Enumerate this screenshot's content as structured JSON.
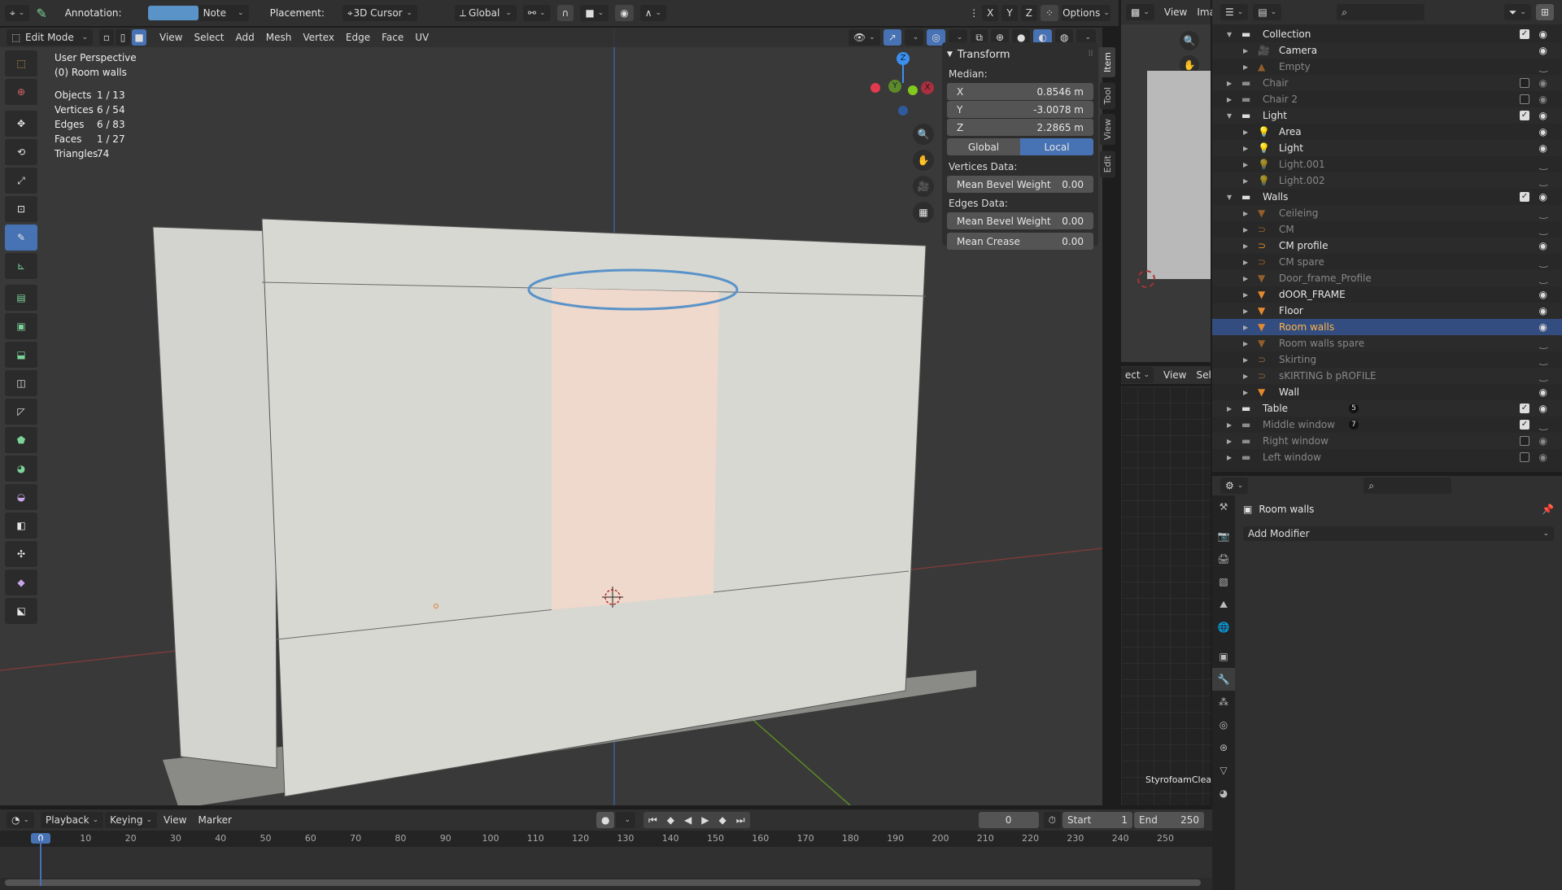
{
  "top_header": {
    "annotation_label": "Annotation:",
    "annotation_color": "#5a93c8",
    "annotation_placement_mode": "Note",
    "placement_label": "Placement:",
    "placement_value": "3D Cursor",
    "orientation": "Global",
    "axis_buttons": [
      "X",
      "Y",
      "Z"
    ],
    "options_label": "Options"
  },
  "viewport_header": {
    "mode": "Edit Mode",
    "menus": [
      "View",
      "Select",
      "Add",
      "Mesh",
      "Vertex",
      "Edge",
      "Face",
      "UV"
    ]
  },
  "overlay": {
    "view_name": "User Perspective",
    "object_name": "(0) Room walls",
    "stats": [
      {
        "label": "Objects",
        "value": "1 / 13"
      },
      {
        "label": "Vertices",
        "value": "6 / 54"
      },
      {
        "label": "Edges",
        "value": "6 / 83"
      },
      {
        "label": "Faces",
        "value": "1 / 27"
      },
      {
        "label": "Triangles",
        "value": "74"
      }
    ]
  },
  "tools": [
    "select-box",
    "cursor",
    "move",
    "rotate",
    "scale",
    "transform",
    "annotate",
    "measure",
    "extrude-region",
    "inset-faces",
    "bevel",
    "loop-cut",
    "knife",
    "poly-build",
    "spin",
    "smooth",
    "edge-slide",
    "shrink-fatten",
    "shear",
    "rip-region"
  ],
  "active_tool": "annotate",
  "gizmo": {
    "x": "X",
    "y": "Y",
    "z": "Z",
    "colors": {
      "x": "#e3394f",
      "y": "#82c91e",
      "z": "#3b8ff0"
    }
  },
  "transform_panel": {
    "title": "Transform",
    "median_label": "Median:",
    "x": {
      "label": "X",
      "value": "0.8546 m"
    },
    "y": {
      "label": "Y",
      "value": "-3.0078 m"
    },
    "z": {
      "label": "Z",
      "value": "2.2865 m"
    },
    "space_options": [
      "Global",
      "Local"
    ],
    "space_active": "Local",
    "vertices_data_label": "Vertices Data:",
    "vertices_bevel": {
      "label": "Mean Bevel Weight",
      "value": "0.00"
    },
    "edges_data_label": "Edges Data:",
    "edges_bevel": {
      "label": "Mean Bevel Weight",
      "value": "0.00"
    },
    "edges_crease": {
      "label": "Mean Crease",
      "value": "0.00"
    }
  },
  "sidebar_tabs": [
    "Item",
    "Tool",
    "View",
    "Edit"
  ],
  "sidebar_active": "Item",
  "image_editor": {
    "menus": [
      "View",
      "Ima"
    ],
    "lower_menus": [
      "ect",
      "View",
      "Sel"
    ],
    "node_label": "StyrofoamClean"
  },
  "outliner": {
    "rows": [
      {
        "name": "Collection",
        "type": "collection",
        "depth": 1,
        "expanded": true,
        "checked": true,
        "visible": true,
        "dim": false
      },
      {
        "name": "Camera",
        "type": "camera",
        "depth": 2,
        "visible": true,
        "dim": false
      },
      {
        "name": "Empty",
        "type": "image-empty",
        "depth": 2,
        "visible": false,
        "dim": true
      },
      {
        "name": "Chair",
        "type": "collection",
        "depth": 1,
        "checked": false,
        "visible": true,
        "dim": true
      },
      {
        "name": "Chair 2",
        "type": "collection",
        "depth": 1,
        "checked": false,
        "visible": true,
        "dim": true
      },
      {
        "name": "Light",
        "type": "collection",
        "depth": 1,
        "expanded": true,
        "checked": true,
        "visible": true,
        "dim": false
      },
      {
        "name": "Area",
        "type": "light",
        "depth": 2,
        "visible": true,
        "dim": false
      },
      {
        "name": "Light",
        "type": "light",
        "depth": 2,
        "visible": true,
        "dim": false
      },
      {
        "name": "Light.001",
        "type": "light",
        "depth": 2,
        "visible": false,
        "dim": true
      },
      {
        "name": "Light.002",
        "type": "light",
        "depth": 2,
        "visible": false,
        "dim": true
      },
      {
        "name": "Walls",
        "type": "collection",
        "depth": 1,
        "expanded": true,
        "checked": true,
        "visible": true,
        "dim": false
      },
      {
        "name": "Ceileing",
        "type": "mesh",
        "depth": 2,
        "visible": false,
        "dim": true
      },
      {
        "name": "CM",
        "type": "curve",
        "depth": 2,
        "visible": false,
        "dim": true
      },
      {
        "name": "CM profile",
        "type": "curve",
        "depth": 2,
        "visible": true,
        "dim": false
      },
      {
        "name": "CM spare",
        "type": "curve",
        "depth": 2,
        "visible": false,
        "dim": true
      },
      {
        "name": "Door_frame_Profile",
        "type": "mesh",
        "depth": 2,
        "visible": false,
        "dim": true
      },
      {
        "name": "dOOR_FRAME",
        "type": "mesh",
        "depth": 2,
        "visible": true,
        "dim": false
      },
      {
        "name": "Floor",
        "type": "mesh",
        "depth": 2,
        "visible": true,
        "dim": false
      },
      {
        "name": "Room walls",
        "type": "mesh",
        "depth": 2,
        "visible": true,
        "dim": false,
        "selected": true
      },
      {
        "name": "Room walls spare",
        "type": "mesh",
        "depth": 2,
        "visible": false,
        "dim": true
      },
      {
        "name": "Skirting",
        "type": "curve",
        "depth": 2,
        "visible": false,
        "dim": true
      },
      {
        "name": "sKIRTING b pROFILE",
        "type": "curve",
        "depth": 2,
        "visible": false,
        "dim": true
      },
      {
        "name": "Wall",
        "type": "mesh",
        "depth": 2,
        "visible": true,
        "dim": false
      },
      {
        "name": "Table",
        "type": "collection",
        "depth": 1,
        "checked": true,
        "visible": true,
        "dim": false,
        "badge": "5"
      },
      {
        "name": "Middle window",
        "type": "collection",
        "depth": 1,
        "checked": true,
        "visible": false,
        "dim": true,
        "badge": "7"
      },
      {
        "name": "Right window",
        "type": "collection",
        "depth": 1,
        "checked": false,
        "visible": true,
        "dim": true
      },
      {
        "name": "Left window",
        "type": "collection",
        "depth": 1,
        "checked": false,
        "visible": true,
        "dim": true
      }
    ]
  },
  "properties": {
    "object_name": "Room walls",
    "add_modifier_label": "Add Modifier",
    "tabs": [
      "tool",
      "render",
      "output",
      "view-layer",
      "scene",
      "world",
      "object",
      "modifiers",
      "particles",
      "physics",
      "constraints",
      "data",
      "material"
    ],
    "active_tab": "modifiers"
  },
  "timeline": {
    "menus": [
      "Playback",
      "Keying",
      "View",
      "Marker"
    ],
    "current_frame": "0",
    "start_label": "Start",
    "start": "1",
    "end_label": "End",
    "end": "250",
    "ticks": [
      "0",
      "10",
      "20",
      "30",
      "40",
      "50",
      "60",
      "70",
      "80",
      "90",
      "100",
      "110",
      "120",
      "130",
      "140",
      "150",
      "160",
      "170",
      "180",
      "190",
      "200",
      "210",
      "220",
      "230",
      "240",
      "250"
    ]
  }
}
